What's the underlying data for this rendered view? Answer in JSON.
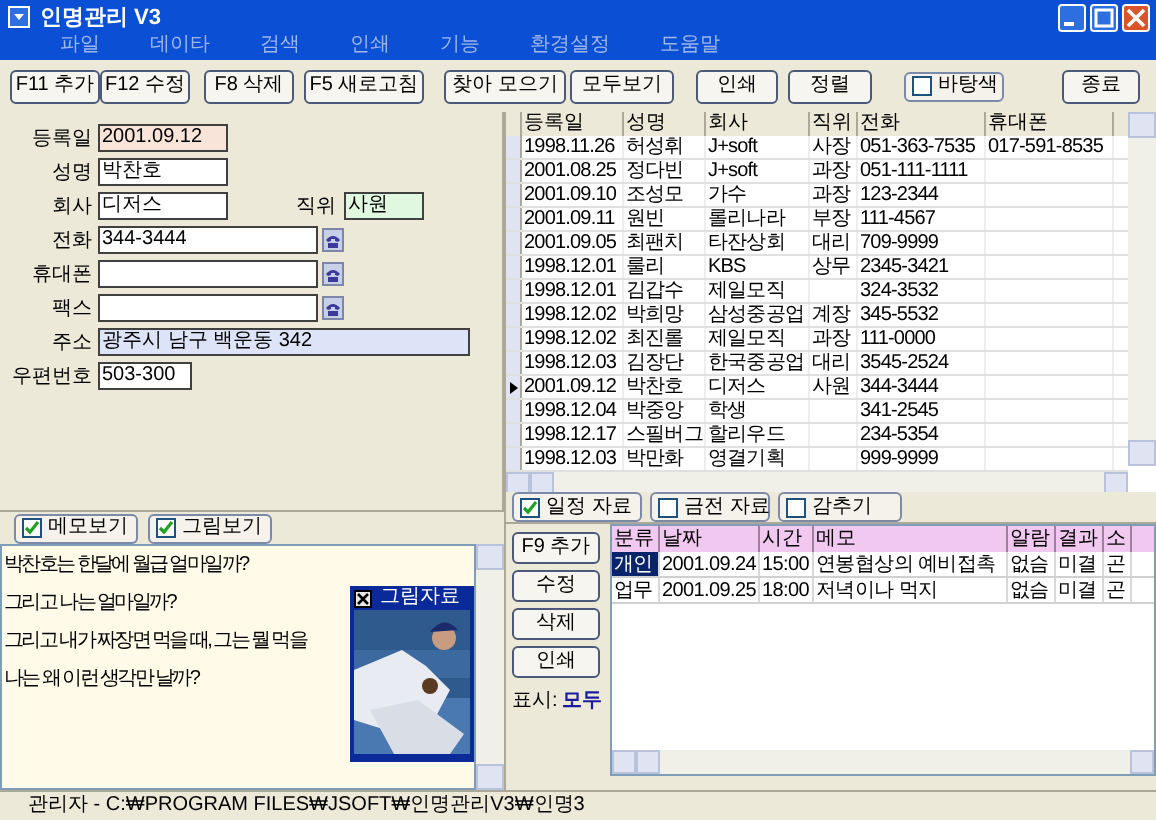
{
  "window": {
    "title": "인명관리 V3"
  },
  "menu": [
    "파일",
    "데이타",
    "검색",
    "인쇄",
    "기능",
    "환경설정",
    "도움말"
  ],
  "toolbar": {
    "buttons": [
      "F11 추가",
      "F12 수정",
      "F8 삭제",
      "F5 새로고침",
      "찾아 모으기",
      "모두보기",
      "인쇄",
      "정렬"
    ],
    "checkbox": {
      "label": "바탕색",
      "checked": false
    },
    "close_button": "종료"
  },
  "form": {
    "rows": [
      [
        {
          "label": "등록일",
          "value": "2001.09.12",
          "color": "#f8e4d8",
          "dial": false
        }
      ],
      [
        {
          "label": "성명",
          "value": "박찬호",
          "color": "#ffffff",
          "dial": false
        }
      ],
      [
        {
          "label": "회사",
          "value": "디저스",
          "color": "#ffffff",
          "dial": false
        },
        {
          "label": "직위",
          "value": "사원",
          "color": "#e0f8e0",
          "dial": false
        }
      ],
      [
        {
          "label": "전화",
          "value": "344-3444",
          "color": "#ffffff",
          "dial": true
        }
      ],
      [
        {
          "label": "휴대폰",
          "color": "#ffffff",
          "dial": true
        }
      ],
      [
        {
          "label": "팩스",
          "color": "#ffffff",
          "dial": true
        }
      ],
      [
        {
          "label": "주소",
          "value": "광주시 남구 백운동 342",
          "color": "#dde4f8",
          "dial": false
        }
      ],
      [
        {
          "label": "우편번호",
          "value": "503-300",
          "color": "#ffffff",
          "dial": false
        }
      ]
    ]
  },
  "contacts": {
    "columns": [
      "등록일",
      "성명",
      "회사",
      "직위",
      "전화",
      "휴대폰"
    ],
    "rows": [
      {
        "cells": [
          "1998.11.26",
          "허성휘",
          "J+soft",
          "사장",
          "051-363-7535",
          "017-591-8535"
        ],
        "selected": false
      },
      {
        "cells": [
          "2001.08.25",
          "정다빈",
          "J+soft",
          "과장",
          "051-111-1111",
          null
        ],
        "selected": false
      },
      {
        "cells": [
          "2001.09.10",
          "조성모",
          "가수",
          "과장",
          "123-2344",
          null
        ],
        "selected": false
      },
      {
        "cells": [
          "2001.09.11",
          "원빈",
          "롤리나라",
          "부장",
          "111-4567",
          null
        ],
        "selected": false
      },
      {
        "cells": [
          "2001.09.05",
          "최팬치",
          "타잔상회",
          "대리",
          "709-9999",
          null
        ],
        "selected": false
      },
      {
        "cells": [
          "1998.12.01",
          "룰리",
          "KBS",
          "상무",
          "2345-3421",
          null
        ],
        "selected": false
      },
      {
        "cells": [
          "1998.12.01",
          "김갑수",
          "제일모직",
          null,
          "324-3532",
          null
        ],
        "selected": false
      },
      {
        "cells": [
          "1998.12.02",
          "박희망",
          "삼성중공업",
          "계장",
          "345-5532",
          null
        ],
        "selected": false
      },
      {
        "cells": [
          "1998.12.02",
          "최진롤",
          "제일모직",
          "과장",
          "111-0000",
          null
        ],
        "selected": false
      },
      {
        "cells": [
          "1998.12.03",
          "김장단",
          "한국중공업",
          "대리",
          "3545-2524",
          null
        ],
        "selected": false
      },
      {
        "cells": [
          "2001.09.12",
          "박찬호",
          "디저스",
          "사원",
          "344-3444",
          null
        ],
        "selected": true
      },
      {
        "cells": [
          "1998.12.04",
          "박중앙",
          "학생",
          null,
          "341-2545",
          null
        ],
        "selected": false
      },
      {
        "cells": [
          "1998.12.17",
          "스필버그",
          "할리우드",
          null,
          "234-5354",
          null
        ],
        "selected": false
      },
      {
        "cells": [
          "1998.12.03",
          "박만화",
          "영결기획",
          null,
          "999-9999",
          null
        ],
        "selected": false
      }
    ]
  },
  "data_tabs": [
    {
      "label": "일정 자료",
      "checked": true
    },
    {
      "label": "금전 자료",
      "checked": false
    },
    {
      "label": "감추기",
      "checked": false
    }
  ],
  "memo_toggles": [
    {
      "label": "메모보기",
      "checked": true
    },
    {
      "label": "그림보기",
      "checked": true
    }
  ],
  "memo": {
    "lines": [
      "박찬호는 한달에 월급 얼마일까?",
      "그리고 나는 얼마일까?",
      "그리고 내가 짜장면 먹을 때, 그는 뭘 먹을",
      "나는 왜 이런 생각만 날까?"
    ],
    "picture_window": {
      "title": "그림자료",
      "kind": "picture"
    }
  },
  "schedule": {
    "buttons": [
      "F9 추가",
      "수정",
      "삭제",
      "인쇄"
    ],
    "filter_label": "표시:",
    "filter_value": "모두",
    "columns": [
      "분류",
      "날짜",
      "시간",
      "메모",
      "알람",
      "결과",
      "소"
    ],
    "rows": [
      {
        "cells": [
          "개인",
          "2001.09.24",
          "15:00",
          "연봉협상의 예비접촉",
          "없슴",
          "미결",
          "곤"
        ],
        "selected": true
      },
      {
        "cells": [
          "업무",
          "2001.09.25",
          "18:00",
          "저녁이나 먹지",
          "없슴",
          "미결",
          "곤"
        ],
        "selected": false
      }
    ]
  },
  "status_bar": "관리자 - C:₩PROGRAM FILES₩JSOFT₩인명관리V3₩인명3"
}
